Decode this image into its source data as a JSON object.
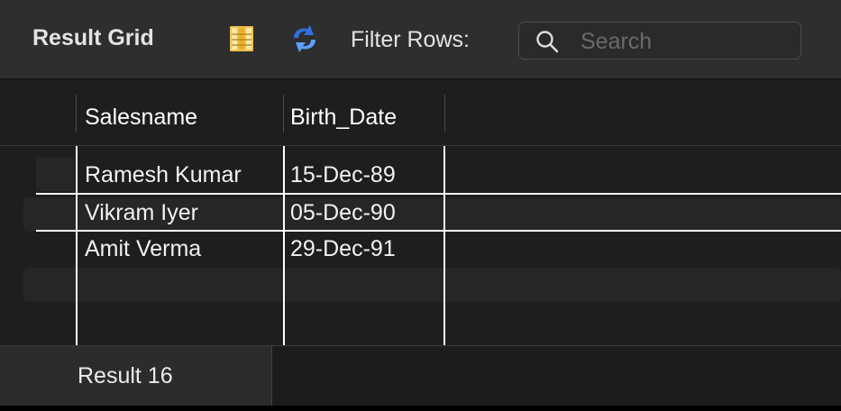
{
  "toolbar": {
    "title": "Result Grid",
    "filter_label": "Filter Rows:",
    "search_placeholder": "Search",
    "icons": {
      "grid_view": "columns-grid-icon",
      "refresh": "refresh-icon",
      "search": "search-icon"
    }
  },
  "grid": {
    "columns": [
      "Salesname",
      "Birth_Date"
    ],
    "rows": [
      [
        "Ramesh Kumar",
        "15-Dec-89"
      ],
      [
        "Vikram Iyer",
        "05-Dec-90"
      ],
      [
        "Amit Verma",
        "29-Dec-91"
      ]
    ]
  },
  "tabs": [
    {
      "label": "Result 16",
      "active": true
    }
  ],
  "colors": {
    "background": "#1e1e1e",
    "toolbar": "#2e2e2e",
    "grid_lines": "#ffffff",
    "refresh_icon": "#3b82f6",
    "grid_icon": "#f2c14e"
  }
}
